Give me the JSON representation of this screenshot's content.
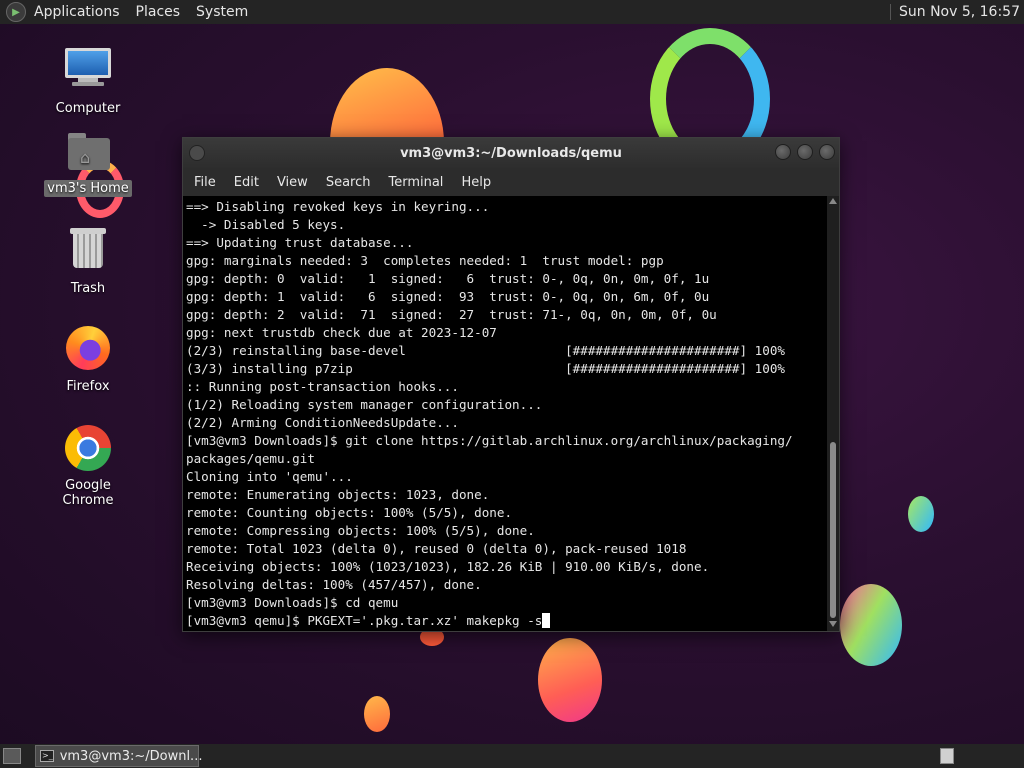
{
  "top_panel": {
    "menus": [
      "Applications",
      "Places",
      "System"
    ],
    "clock": "Sun Nov 5, 16:57"
  },
  "desktop": {
    "icons": [
      {
        "label": "Computer",
        "icon": "computer-icon"
      },
      {
        "label": "vm3's Home",
        "icon": "home-folder-icon"
      },
      {
        "label": "Trash",
        "icon": "trash-icon"
      },
      {
        "label": "Firefox",
        "icon": "firefox-icon"
      },
      {
        "label": "Google Chrome",
        "icon": "chrome-icon"
      }
    ]
  },
  "terminal": {
    "title": "vm3@vm3:~/Downloads/qemu",
    "menus": [
      "File",
      "Edit",
      "View",
      "Search",
      "Terminal",
      "Help"
    ],
    "lines": [
      "==> Disabling revoked keys in keyring...",
      "  -> Disabled 5 keys.",
      "==> Updating trust database...",
      "gpg: marginals needed: 3  completes needed: 1  trust model: pgp",
      "gpg: depth: 0  valid:   1  signed:   6  trust: 0-, 0q, 0n, 0m, 0f, 1u",
      "gpg: depth: 1  valid:   6  signed:  93  trust: 0-, 0q, 0n, 6m, 0f, 0u",
      "gpg: depth: 2  valid:  71  signed:  27  trust: 71-, 0q, 0n, 0m, 0f, 0u",
      "gpg: next trustdb check due at 2023-12-07",
      "(2/3) reinstalling base-devel                     [######################] 100%",
      "(3/3) installing p7zip                            [######################] 100%",
      ":: Running post-transaction hooks...",
      "(1/2) Reloading system manager configuration...",
      "(2/2) Arming ConditionNeedsUpdate...",
      "[vm3@vm3 Downloads]$ git clone https://gitlab.archlinux.org/archlinux/packaging/",
      "packages/qemu.git",
      "Cloning into 'qemu'...",
      "remote: Enumerating objects: 1023, done.",
      "remote: Counting objects: 100% (5/5), done.",
      "remote: Compressing objects: 100% (5/5), done.",
      "remote: Total 1023 (delta 0), reused 0 (delta 0), pack-reused 1018",
      "Receiving objects: 100% (1023/1023), 182.26 KiB | 910.00 KiB/s, done.",
      "Resolving deltas: 100% (457/457), done.",
      "[vm3@vm3 Downloads]$ cd qemu"
    ],
    "prompt_line": "[vm3@vm3 qemu]$ PKGEXT='.pkg.tar.xz' makepkg -s"
  },
  "taskbar": {
    "task_label": "vm3@vm3:~/Downl..."
  }
}
